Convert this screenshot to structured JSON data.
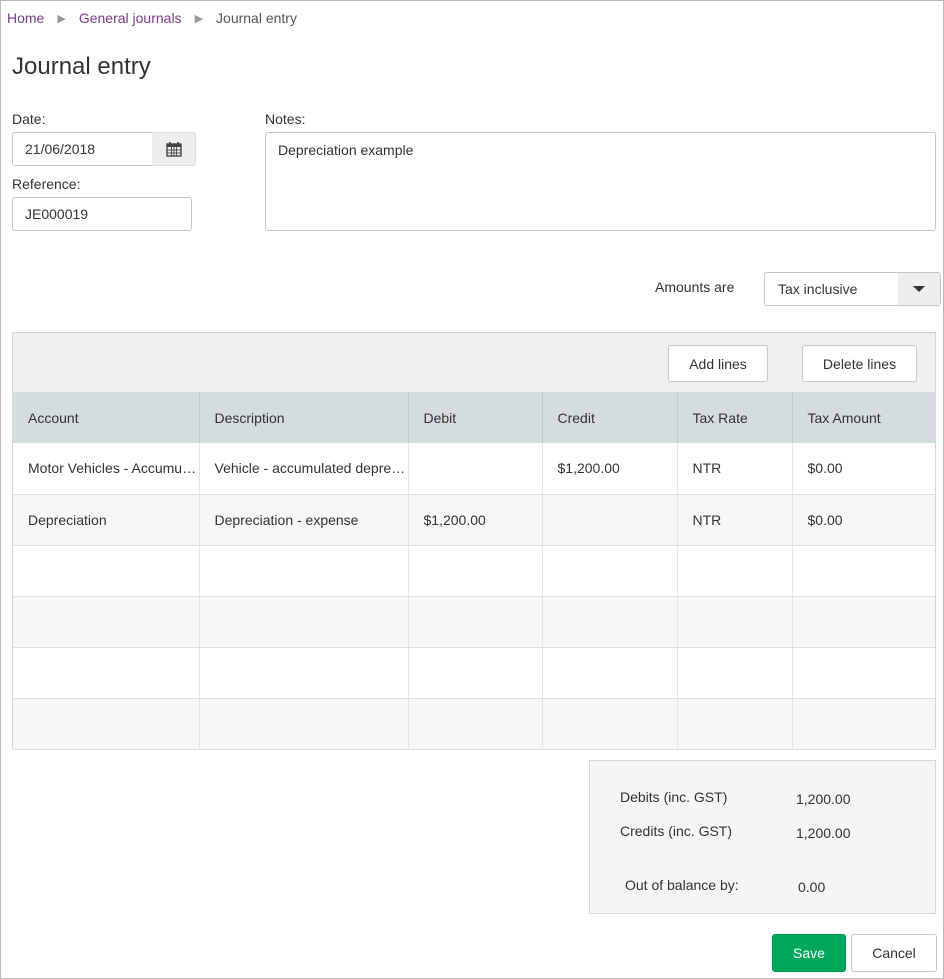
{
  "breadcrumb": {
    "home": "Home",
    "general_journals": "General journals",
    "current": "Journal entry"
  },
  "page_title": "Journal entry",
  "form": {
    "date_label": "Date:",
    "date_value": "21/06/2018",
    "reference_label": "Reference:",
    "reference_value": "JE000019",
    "notes_label": "Notes:",
    "notes_value": "Depreciation example",
    "amounts_label": "Amounts are",
    "amounts_value": "Tax inclusive"
  },
  "toolbar": {
    "add_lines": "Add lines",
    "delete_lines": "Delete lines"
  },
  "grid": {
    "headers": [
      "Account",
      "Description",
      "Debit",
      "Credit",
      "Tax Rate",
      "Tax Amount"
    ],
    "rows": [
      [
        "Motor Vehicles - Accumulated Depreciation",
        "Vehicle - accumulated depreciation",
        "",
        "$1,200.00",
        "NTR",
        "$0.00"
      ],
      [
        "Depreciation",
        "Depreciation - expense",
        "$1,200.00",
        "",
        "NTR",
        "$0.00"
      ],
      [
        "",
        "",
        "",
        "",
        "",
        ""
      ],
      [
        "",
        "",
        "",
        "",
        "",
        ""
      ],
      [
        "",
        "",
        "",
        "",
        "",
        ""
      ],
      [
        "",
        "",
        "",
        "",
        "",
        ""
      ]
    ]
  },
  "totals": {
    "debits_label": "Debits (inc. GST)",
    "debits_value": "1,200.00",
    "credits_label": "Credits (inc. GST)",
    "credits_value": "1,200.00",
    "balance_label": "Out of balance by:",
    "balance_value": "0.00"
  },
  "actions": {
    "save": "Save",
    "cancel": "Cancel"
  },
  "colors": {
    "link": "#7a3a8c",
    "save_button": "#00a65a",
    "header_bg": "#d5dcde"
  },
  "icons": {
    "calendar": "calendar-icon",
    "dropdown": "chevron-down-icon",
    "breadcrumb_separator": "triangle-right-icon"
  }
}
